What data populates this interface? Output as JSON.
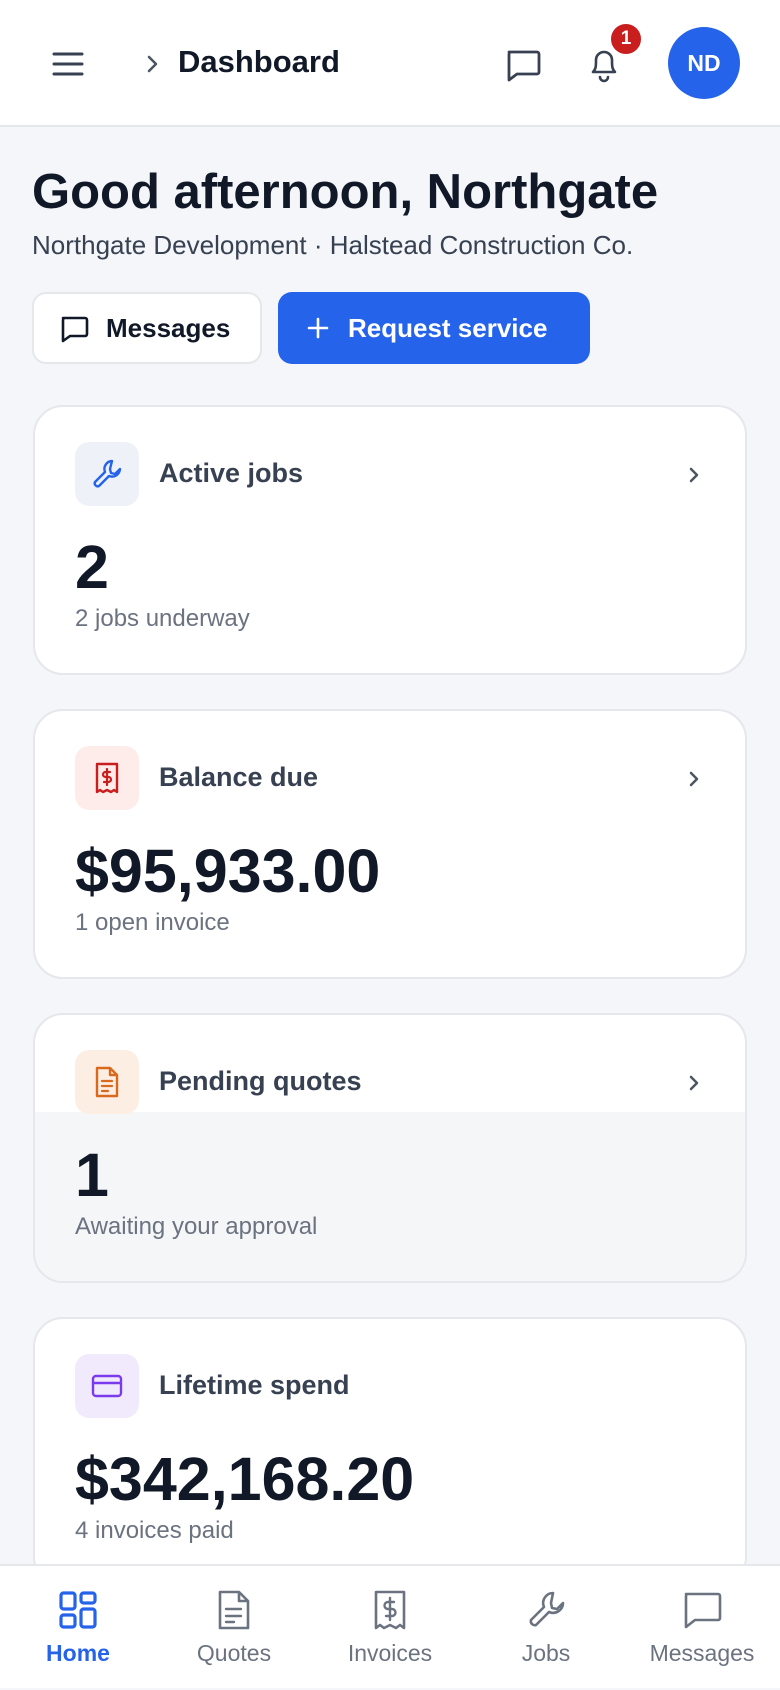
{
  "header": {
    "breadcrumb_title": "Dashboard",
    "notification_count": "1",
    "avatar_initials": "ND"
  },
  "greeting": {
    "title": "Good afternoon, Northgate",
    "subtitle": "Northgate Development · Halstead Construction Co."
  },
  "actions": {
    "messages_label": "Messages",
    "request_label": "Request service"
  },
  "cards": [
    {
      "label": "Active jobs",
      "value": "2",
      "sub": "2 jobs underway",
      "icon": "wrench-icon",
      "icon_color": "#2563eb",
      "icon_bg": "#eef1f8"
    },
    {
      "label": "Balance due",
      "value": "$95,933.00",
      "sub": "1 open invoice",
      "icon": "receipt-icon",
      "icon_color": "#c81e1e",
      "icon_bg": "#fdecea"
    },
    {
      "label": "Pending quotes",
      "value": "1",
      "sub": "Awaiting your approval",
      "icon": "document-icon",
      "icon_color": "#d9691c",
      "icon_bg": "#fdeee3"
    },
    {
      "label": "Lifetime spend",
      "value": "$342,168.20",
      "sub": "4 invoices paid",
      "icon": "credit-card-icon",
      "icon_color": "#7c3aed",
      "icon_bg": "#f1eafd"
    }
  ],
  "nav": [
    {
      "label": "Home",
      "icon": "grid-icon",
      "active": true
    },
    {
      "label": "Quotes",
      "icon": "document-icon",
      "active": false
    },
    {
      "label": "Invoices",
      "icon": "receipt-icon",
      "active": false
    },
    {
      "label": "Jobs",
      "icon": "wrench-icon",
      "active": false
    },
    {
      "label": "Messages",
      "icon": "chat-icon",
      "active": false
    }
  ],
  "colors": {
    "accent": "#2563eb",
    "badge": "#c81e1e"
  }
}
